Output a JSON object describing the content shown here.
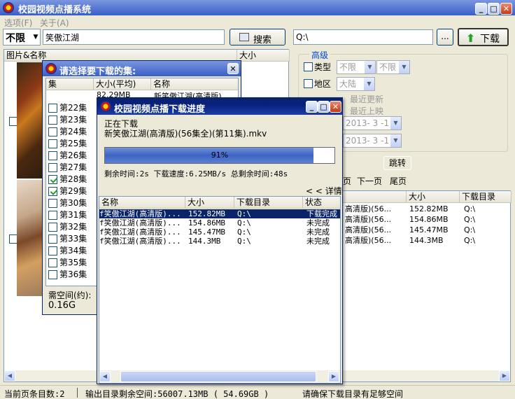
{
  "app": {
    "title": "校园视频点播系统",
    "menu": [
      "选项(F)",
      "关于(A)"
    ],
    "search": {
      "scope": "不限",
      "query": "笑傲江湖",
      "search_label": "搜索",
      "path": "Q:\\",
      "browse_label": "...",
      "download_label": "下载"
    },
    "results_table": {
      "columns": [
        "图片&名称",
        "大小"
      ]
    },
    "filters": {
      "advanced_label": "高级",
      "type_label": "类型",
      "type_values": [
        "不限",
        "不限"
      ],
      "region_label": "地区",
      "region_value": "大陆",
      "sort_options": [
        "最近更新",
        "最近上映"
      ],
      "date_from": "2013- 3 -11",
      "date_to": "2013- 3 -11"
    },
    "pager": {
      "jump_label": "跳转",
      "prev_partial": "页",
      "next_label": "下一页",
      "last_label": "尾页"
    },
    "right_list": {
      "columns": [
        "大小",
        "下载目录"
      ],
      "rows": [
        {
          "name": "高清版)(56...",
          "size": "152.82MB",
          "dir": "Q:\\"
        },
        {
          "name": "高清版)(56...",
          "size": "154.86MB",
          "dir": "Q:\\"
        },
        {
          "name": "高清版)(56...",
          "size": "145.47MB",
          "dir": "Q:\\"
        },
        {
          "name": "高清版)(56...",
          "size": "144.3MB",
          "dir": "Q:\\"
        }
      ]
    },
    "status": {
      "count": "当前页条目数:2",
      "space": "输出目录剩余空间:56007.13MB ( 54.69GB )",
      "hint": "请确保下载目录有足够空间"
    }
  },
  "episode_dialog": {
    "title": "请选择要下载的集:",
    "columns": [
      "集",
      "大小(平均)",
      "名称"
    ],
    "first_row_size": "82.29MB",
    "first_row_name": "新笑傲江湖(高清版)",
    "episodes": [
      {
        "label": "第22集",
        "checked": false
      },
      {
        "label": "第23集",
        "checked": false
      },
      {
        "label": "第24集",
        "checked": false
      },
      {
        "label": "第25集",
        "checked": false
      },
      {
        "label": "第26集",
        "checked": false
      },
      {
        "label": "第27集",
        "checked": false
      },
      {
        "label": "第28集",
        "checked": true
      },
      {
        "label": "第29集",
        "checked": true
      },
      {
        "label": "第30集",
        "checked": false
      },
      {
        "label": "第31集",
        "checked": false
      },
      {
        "label": "第32集",
        "checked": false
      },
      {
        "label": "第33集",
        "checked": false
      },
      {
        "label": "第34集",
        "checked": false
      },
      {
        "label": "第35集",
        "checked": false
      },
      {
        "label": "第36集",
        "checked": false
      }
    ],
    "space_label": "需空间(约):",
    "space_value": "0.16G"
  },
  "progress_dialog": {
    "title": "校园视频点播下载进度",
    "status_line": "正在下载",
    "file_name": "新笑傲江湖(高清版)(56集全)(第11集).mkv",
    "progress": 0.91,
    "progress_text": "91%",
    "remaining_time": "剩余时间:2s",
    "speed": "下载速度:6.25MB/s",
    "total_remaining": "总剩余时间:48s",
    "details_label": "< < 详情",
    "columns": [
      "名称",
      "大小",
      "下载目录",
      "状态"
    ],
    "rows": [
      {
        "name": "f笑傲江湖(高清版)...",
        "size": "152.82MB",
        "dir": "Q:\\",
        "status": "下载完成"
      },
      {
        "name": "f笑傲江湖(高清版)...",
        "size": "154.86MB",
        "dir": "Q:\\",
        "status": "未完成"
      },
      {
        "name": "f笑傲江湖(高清版)...",
        "size": "145.47MB",
        "dir": "Q:\\",
        "status": "未完成"
      },
      {
        "name": "f笑傲江湖(高清版)...",
        "size": "144.3MB",
        "dir": "Q:\\",
        "status": "未完成"
      }
    ]
  },
  "colors": {
    "title_active": "#0a246a",
    "progress_fill": "#3d64c4",
    "selected_row": "#0a246a"
  }
}
